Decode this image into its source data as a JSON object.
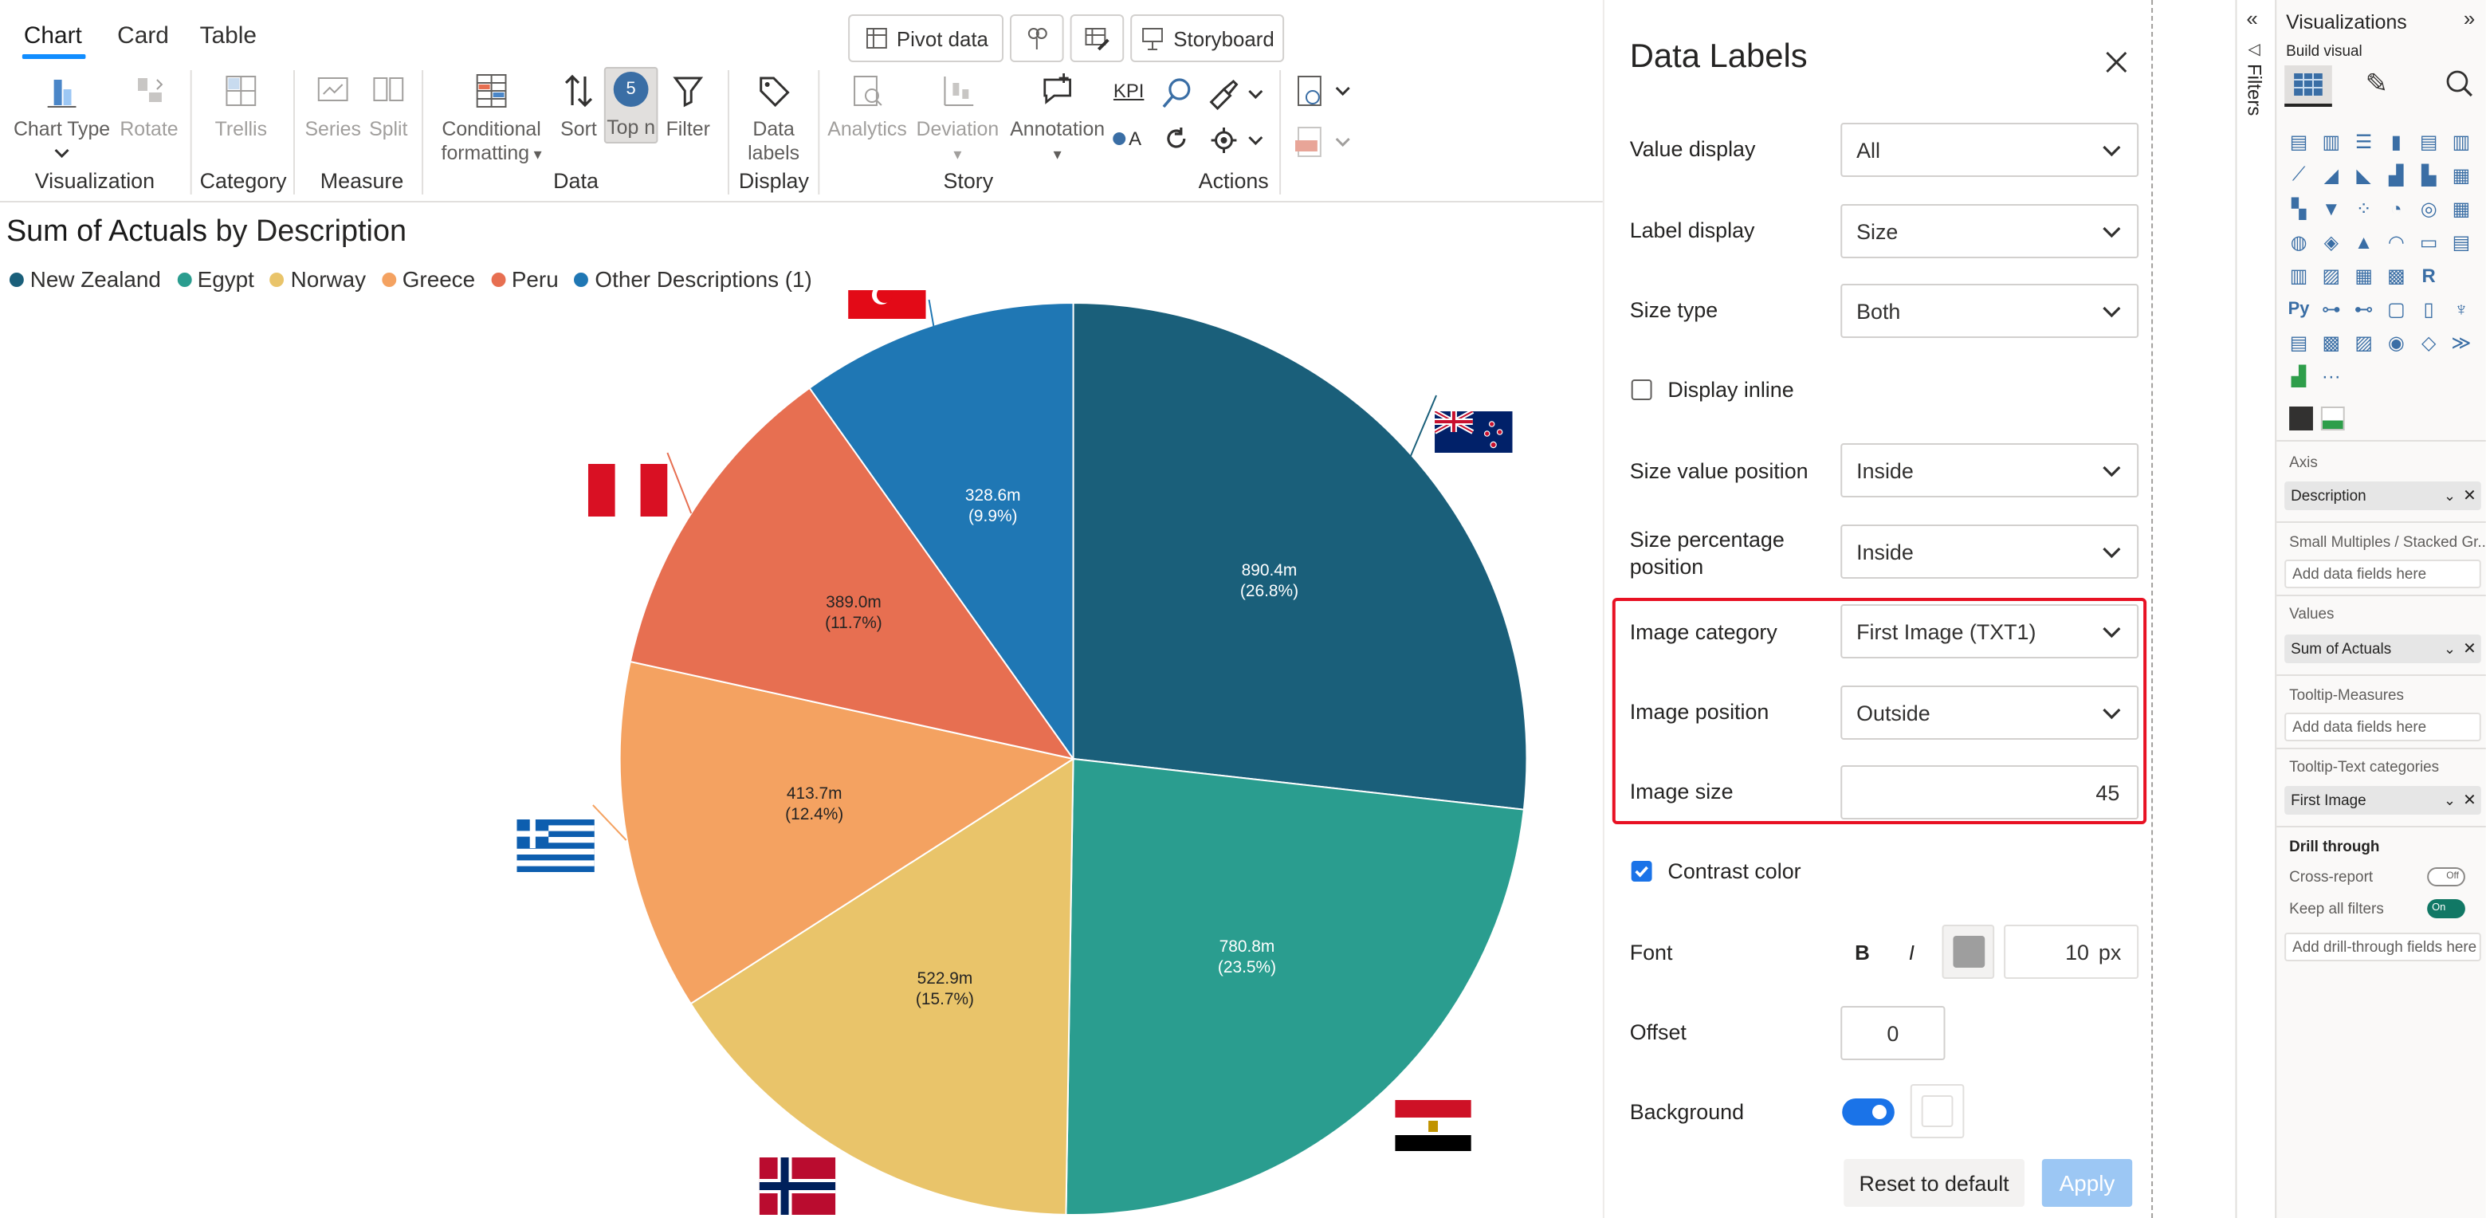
{
  "tabs": {
    "chart": "Chart",
    "card": "Card",
    "table": "Table"
  },
  "topbar": {
    "pivot": "Pivot data",
    "storyboard": "Storyboard"
  },
  "ribbon": {
    "chart_type": "Chart Type",
    "rotate": "Rotate",
    "trellis": "Trellis",
    "series": "Series",
    "split": "Split",
    "cond_fmt_1": "Conditional",
    "cond_fmt_2": "formatting",
    "sort": "Sort",
    "topn": "Top n",
    "topn_badge": "5",
    "filter": "Filter",
    "data_labels_1": "Data",
    "data_labels_2": "labels",
    "analytics": "Analytics",
    "deviation": "Deviation",
    "annotation": "Annotation",
    "kpi": "KPI",
    "oa": "A",
    "groups": {
      "visualization": "Visualization",
      "category": "Category",
      "measure": "Measure",
      "data": "Data",
      "display": "Display",
      "story": "Story",
      "actions": "Actions"
    }
  },
  "chart": {
    "title_bold": "Sum of Actuals",
    "title_rest": "by Description",
    "legend": [
      {
        "name": "New Zealand",
        "color": "#1a5f7a"
      },
      {
        "name": "Egypt",
        "color": "#2a9d8f"
      },
      {
        "name": "Norway",
        "color": "#e9c46a"
      },
      {
        "name": "Greece",
        "color": "#f4a261"
      },
      {
        "name": "Peru",
        "color": "#e76f51"
      },
      {
        "name": "Other Descriptions (1)",
        "color": "#1f77b4"
      }
    ]
  },
  "chart_data": {
    "type": "pie",
    "title": "Sum of Actuals by Description",
    "categories": [
      "New Zealand",
      "Egypt",
      "Norway",
      "Greece",
      "Peru",
      "Other Descriptions (1)"
    ],
    "values": [
      890.4,
      780.8,
      522.9,
      413.7,
      389.0,
      328.6
    ],
    "labels": [
      "890.4m",
      "780.8m",
      "522.9m",
      "413.7m",
      "389.0m",
      "328.6m"
    ],
    "percent_labels": [
      "(26.8%)",
      "(23.5%)",
      "(15.7%)",
      "(12.4%)",
      "(11.7%)",
      "(9.9%)"
    ],
    "colors": [
      "#1a5f7a",
      "#2a9d8f",
      "#e9c46a",
      "#f4a261",
      "#e76f51",
      "#1f77b4"
    ],
    "legend_position": "top-left"
  },
  "panel": {
    "title": "Data Labels",
    "value_display": {
      "label": "Value display",
      "value": "All"
    },
    "label_display": {
      "label": "Label display",
      "value": "Size"
    },
    "size_type": {
      "label": "Size type",
      "value": "Both"
    },
    "display_inline": "Display inline",
    "size_value_position": {
      "label": "Size value position",
      "value": "Inside"
    },
    "size_pct_position": {
      "label1": "Size percentage",
      "label2": "position",
      "value": "Inside"
    },
    "image_category": {
      "label": "Image category",
      "value": "First Image (TXT1)"
    },
    "image_position": {
      "label": "Image position",
      "value": "Outside"
    },
    "image_size": {
      "label": "Image size",
      "value": "45"
    },
    "contrast_color": "Contrast color",
    "font": {
      "label": "Font",
      "bold": "B",
      "italic": "I",
      "size": "10",
      "unit": "px"
    },
    "offset": {
      "label": "Offset",
      "value": "0"
    },
    "background": "Background",
    "reset": "Reset to default",
    "apply": "Apply"
  },
  "filters_label": "Filters",
  "vis": {
    "title": "Visualizations",
    "build": "Build visual",
    "axis": "Axis",
    "axis_field": "Description",
    "small_multiples": "Small Multiples / Stacked Gr...",
    "add_fields": "Add data fields here",
    "values": "Values",
    "values_field": "Sum of Actuals",
    "tooltip_measures": "Tooltip-Measures",
    "tooltip_text": "Tooltip-Text categories",
    "tooltip_field": "First Image",
    "drill": "Drill through",
    "cross_report": "Cross-report",
    "cross_state": "Off",
    "keep_filters": "Keep all filters",
    "keep_state": "On",
    "add_drill": "Add drill-through fields here",
    "py": "Py",
    "r": "R",
    "more": "···"
  }
}
